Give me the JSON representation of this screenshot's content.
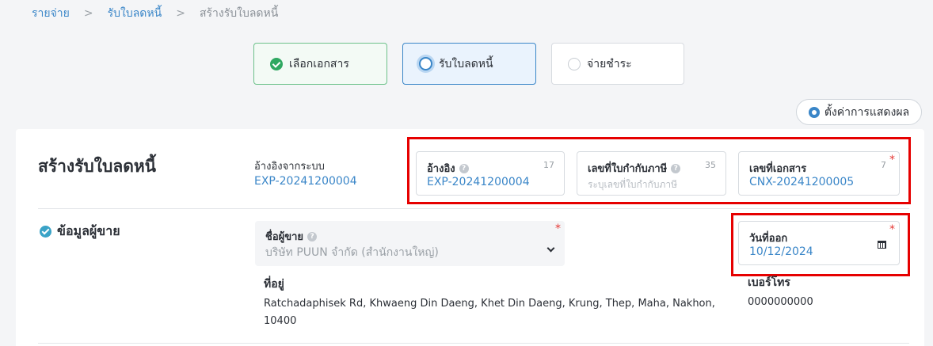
{
  "breadcrumb": {
    "items": [
      "รายจ่าย",
      "รับใบลดหนี้"
    ],
    "separator": ">",
    "current": "สร้างรับใบลดหนี้"
  },
  "steps": [
    {
      "label": "เลือกเอกสาร",
      "state": "done"
    },
    {
      "label": "รับใบลดหนี้",
      "state": "active"
    },
    {
      "label": "จ่ายชำระ",
      "state": "todo"
    }
  ],
  "settings_label": "ตั้งค่าการแสดงผล",
  "header": {
    "title": "สร้างรับใบลดหนี้",
    "system_ref_label": "อ้างอิงจากระบบ",
    "system_ref_value": "EXP-20241200004"
  },
  "fields": {
    "reference": {
      "label": "อ้างอิง",
      "count": "17",
      "value": "EXP-20241200004"
    },
    "tax_invoice": {
      "label": "เลขที่ใบกำกับภาษี",
      "count": "35",
      "placeholder": "ระบุเลขที่ใบกำกับภาษี"
    },
    "doc_number": {
      "label": "เลขที่เอกสาร",
      "count": "7",
      "value": "CNX-20241200005",
      "required": "*"
    },
    "issue_date": {
      "label": "วันที่ออก",
      "value": "10/12/2024",
      "required": "*"
    }
  },
  "seller_section": {
    "title": "ข้อมูลผู้ขาย",
    "seller_label": "ชื่อผู้ขาย",
    "seller_value": "บริษัท PUUN จำกัด (สำนักงานใหญ่)",
    "required": "*",
    "address_label": "ที่อยู่",
    "address_value": "Ratchadaphisek Rd, Khwaeng Din Daeng, Khet Din Daeng, Krung, Thep, Maha, Nakhon, 10400",
    "phone_label": "เบอร์โทร",
    "phone_value": "0000000000"
  },
  "colors": {
    "accent": "#3a86c8",
    "success": "#2fa861",
    "highlight": "#e60000",
    "required": "#e53935"
  }
}
